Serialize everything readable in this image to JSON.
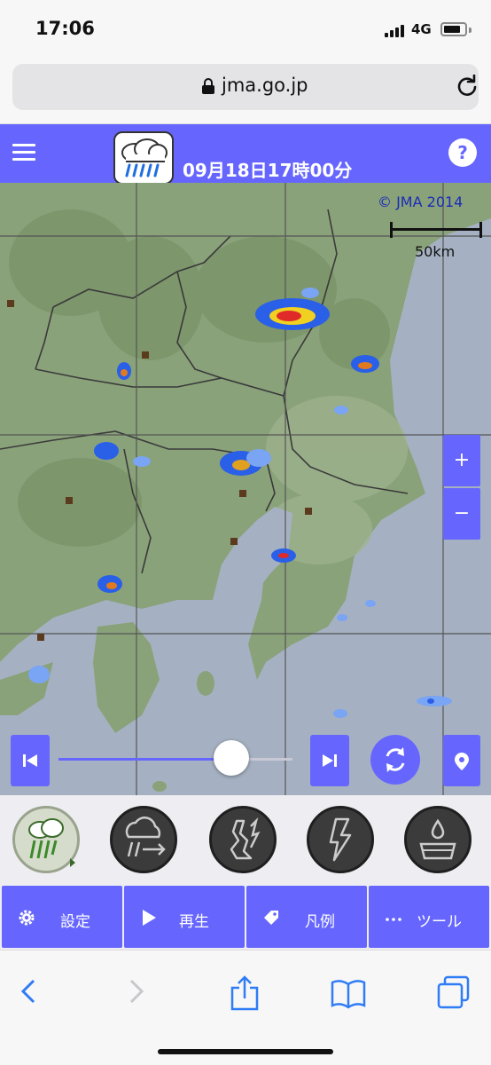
{
  "status_bar": {
    "time": "17:06",
    "network": "4G"
  },
  "browser": {
    "url": "jma.go.jp"
  },
  "header": {
    "datetime": "09月18日17時00分",
    "help_label": "?"
  },
  "map": {
    "copyright": "© JMA 2014",
    "scale_label": "50km",
    "zoom_in_label": "+",
    "zoom_out_label": "−"
  },
  "playback": {
    "slider_position": 0.74
  },
  "layers": [
    {
      "name": "rain-radar",
      "icon": "cloud-rain-icon",
      "active": true
    },
    {
      "name": "rain-forecast",
      "icon": "cloud-arrow-icon",
      "active": false
    },
    {
      "name": "tornado",
      "icon": "tornado-icon",
      "active": false
    },
    {
      "name": "lightning",
      "icon": "lightning-icon",
      "active": false
    },
    {
      "name": "precipitation",
      "icon": "water-drop-icon",
      "active": false
    }
  ],
  "menu": {
    "settings": "設定",
    "play": "再生",
    "legend": "凡例",
    "tools": "ツール"
  },
  "colors": {
    "accent": "#6666ff",
    "map_land": "#8aa27a",
    "map_sea": "#a5b1c2"
  }
}
